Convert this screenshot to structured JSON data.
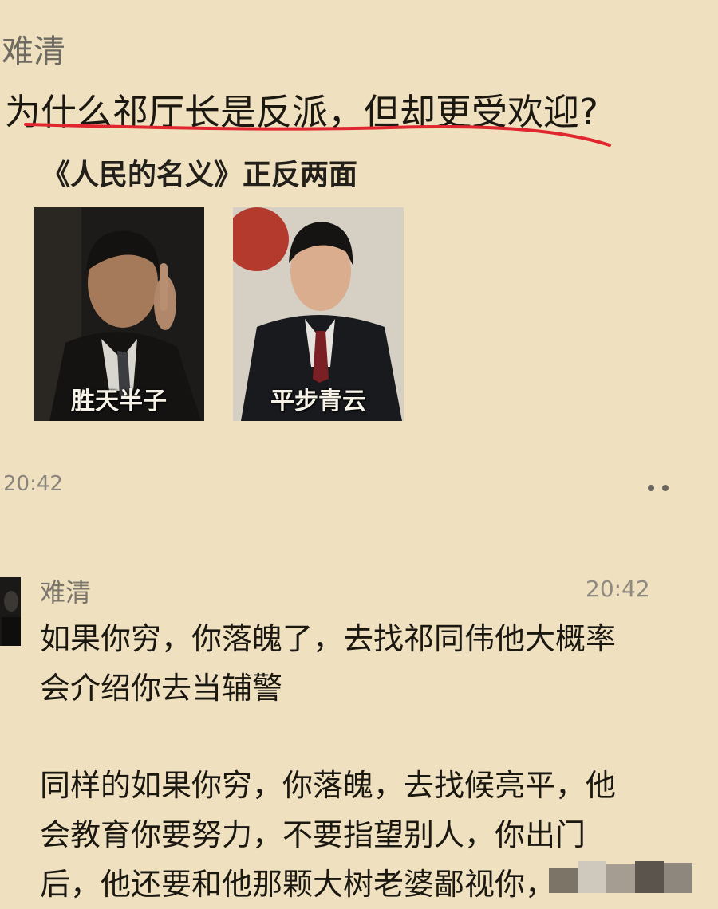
{
  "post": {
    "author": "难清",
    "question": "为什么祁厅长是反派，但却更受欢迎?",
    "image_heading": "《人民的名义》正反两面",
    "image_captions": [
      "胜天半子",
      "平步青云"
    ],
    "time": "20:42"
  },
  "comment": {
    "author": "难清",
    "time": "20:42",
    "paragraphs": [
      [
        "如果你穷，你落魄了，去找祁同伟他大概率",
        "会介绍你去当辅警"
      ],
      [
        "同样的如果你穷，你落魄，去找候亮平，他",
        "会教育你要努力，不要指望别人，你出门",
        "后，他还要和他那颗大树老婆鄙视你，"
      ]
    ]
  },
  "colors": {
    "background": "#efe1bf",
    "underline_red": "#e0262e",
    "text_dark": "#1b1711",
    "text_muted": "#8a857c"
  }
}
